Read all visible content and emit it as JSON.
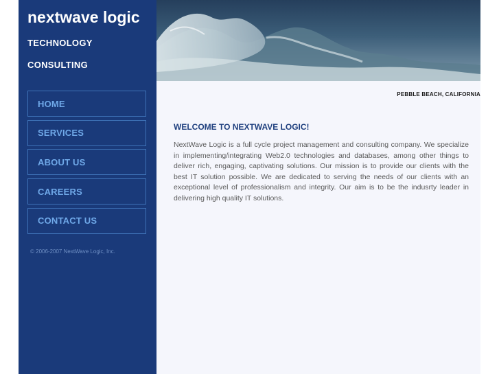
{
  "brand": {
    "title": "nextwave logic",
    "line1": "TECHNOLOGY",
    "line2": "CONSULTING"
  },
  "nav": [
    {
      "label": "HOME"
    },
    {
      "label": "SERVICES"
    },
    {
      "label": "ABOUT US"
    },
    {
      "label": "CAREERS"
    },
    {
      "label": "CONTACT US"
    }
  ],
  "copyright": "© 2006-2007 NextWave Logic, Inc.",
  "location": "PEBBLE BEACH, CALIFORNIA",
  "welcome": {
    "title": "WELCOME TO NEXTWAVE LOGIC!",
    "body": "NextWave Logic is a full cycle project management and consulting company. We specialize in implementing/integrating Web2.0 technologies and databases, among other things to deliver rich, engaging, captivating solutions. Our mission is to provide our clients with the best IT solution possible. We are dedicated to serving the needs of our clients with an exceptional level of professionalism and integrity. Our aim is to be the indusrty leader in delivering high quality IT solutions."
  },
  "colors": {
    "sidebar": "#1a3a7a",
    "nav_border": "#3f73b8",
    "nav_text": "#6fa8e8",
    "heading": "#1e3f7e",
    "content_bg": "#f5f6fc"
  }
}
